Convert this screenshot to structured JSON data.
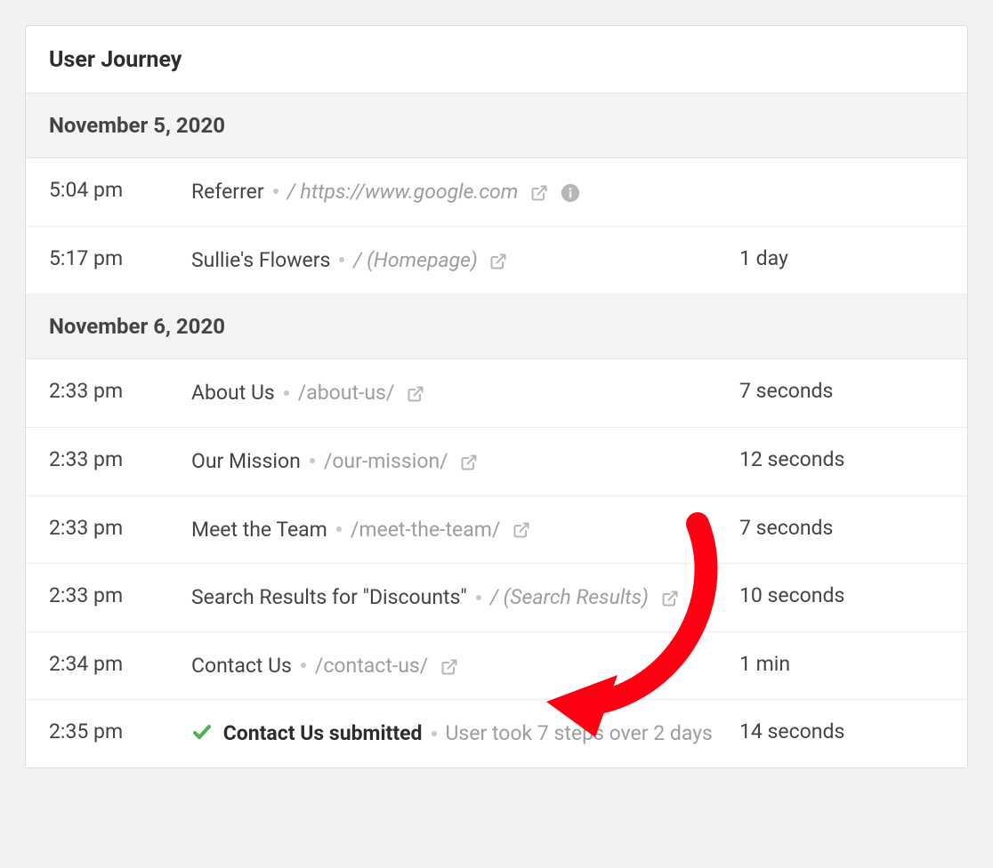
{
  "card": {
    "title": "User Journey"
  },
  "groups": [
    {
      "date": "November 5, 2020",
      "rows": [
        {
          "time": "5:04 pm",
          "title": "Referrer",
          "path": "/ https://www.google.com",
          "path_style": "italic",
          "ext": true,
          "info": true,
          "right": "",
          "check": false,
          "meta": ""
        },
        {
          "time": "5:17 pm",
          "title": "Sullie's Flowers",
          "path": "/ (Homepage)",
          "path_style": "italic",
          "ext": true,
          "info": false,
          "right": "1 day",
          "check": false,
          "meta": ""
        }
      ]
    },
    {
      "date": "November 6, 2020",
      "rows": [
        {
          "time": "2:33 pm",
          "title": "About Us",
          "path": "/about-us/",
          "path_style": "plain",
          "ext": true,
          "info": false,
          "right": "7 seconds",
          "check": false,
          "meta": ""
        },
        {
          "time": "2:33 pm",
          "title": "Our Mission",
          "path": "/our-mission/",
          "path_style": "plain",
          "ext": true,
          "info": false,
          "right": "12 seconds",
          "check": false,
          "meta": ""
        },
        {
          "time": "2:33 pm",
          "title": "Meet the Team",
          "path": "/meet-the-team/",
          "path_style": "plain",
          "ext": true,
          "info": false,
          "right": "7 seconds",
          "check": false,
          "meta": ""
        },
        {
          "time": "2:33 pm",
          "title": "Search Results for \"Discounts\"",
          "path": "/ (Search Results)",
          "path_style": "italic",
          "ext": true,
          "info": true,
          "right": "10 seconds",
          "check": false,
          "meta": ""
        },
        {
          "time": "2:34 pm",
          "title": "Contact Us",
          "path": "/contact-us/",
          "path_style": "plain",
          "ext": true,
          "info": false,
          "right": "1 min",
          "check": false,
          "meta": ""
        },
        {
          "time": "2:35 pm",
          "title": "Contact Us submitted",
          "path": "",
          "path_style": "plain",
          "ext": false,
          "info": false,
          "right": "14 seconds",
          "check": true,
          "meta": "User took 7 steps over 2 days"
        }
      ]
    }
  ]
}
